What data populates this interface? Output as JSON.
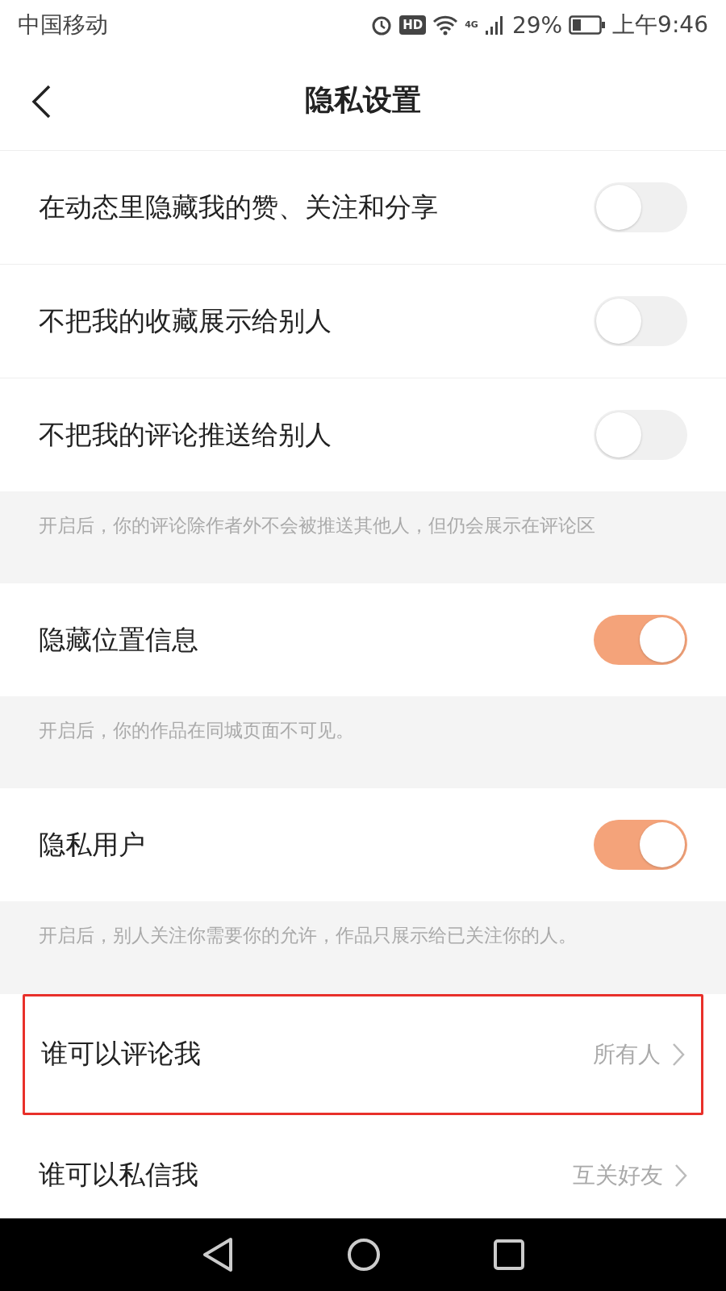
{
  "status_bar": {
    "carrier": "中国移动",
    "hd": "HD",
    "network": "4G",
    "battery": "29%",
    "time": "上午9:46"
  },
  "header": {
    "title": "隐私设置"
  },
  "items": [
    {
      "kind": "toggle",
      "label": "在动态里隐藏我的赞、关注和分享",
      "on": false
    },
    {
      "kind": "toggle",
      "label": "不把我的收藏展示给别人",
      "on": false
    },
    {
      "kind": "toggle",
      "label": "不把我的评论推送给别人",
      "on": false
    },
    {
      "kind": "note",
      "text": "开启后，你的评论除作者外不会被推送其他人，但仍会展示在评论区"
    },
    {
      "kind": "toggle",
      "label": "隐藏位置信息",
      "on": true
    },
    {
      "kind": "note",
      "text": "开启后，你的作品在同城页面不可见。"
    },
    {
      "kind": "toggle",
      "label": "隐私用户",
      "on": true
    },
    {
      "kind": "note",
      "text": "开启后，别人关注你需要你的允许，作品只展示给已关注你的人。"
    },
    {
      "kind": "link",
      "label": "谁可以评论我",
      "value": "所有人",
      "highlighted": true
    },
    {
      "kind": "link",
      "label": "谁可以私信我",
      "value": "互关好友",
      "highlighted": false
    }
  ]
}
